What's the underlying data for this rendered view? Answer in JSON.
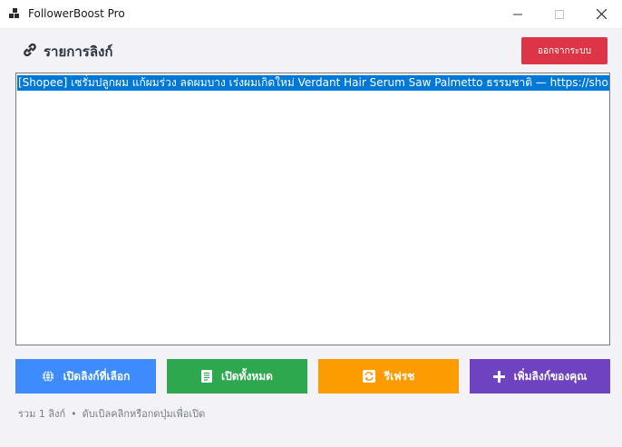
{
  "window": {
    "title": "FollowerBoost Pro"
  },
  "header": {
    "title": "รายการลิงก์",
    "logout_label": "ออกจากระบบ"
  },
  "list": {
    "items": [
      "[Shopee] เซรั่มปลูกผม แก้ผมร่วง ลดผมบาง เร่งผมเกิดใหม่ Verdant Hair Serum Saw Palmetto ธรรมชาติ — https://shopee.co"
    ]
  },
  "actions": {
    "open_selected": "เปิดลิงก์ที่เลือก",
    "open_all": "เปิดทั้งหมด",
    "refresh": "รีเฟรช",
    "add_link": "เพิ่มลิงก์ของคุณ"
  },
  "status": {
    "count": "รวม 1 ลิงก์",
    "separator": "•",
    "hint": "ดับเบิลคลิกหรือกดปุ่มเพื่อเปิด"
  },
  "colors": {
    "logout": "#dc3545",
    "open_selected": "#3d8bfd",
    "open_all": "#2ea84f",
    "refresh": "#fd9c00",
    "add_link": "#6f42c1",
    "selection": "#0078d7"
  }
}
